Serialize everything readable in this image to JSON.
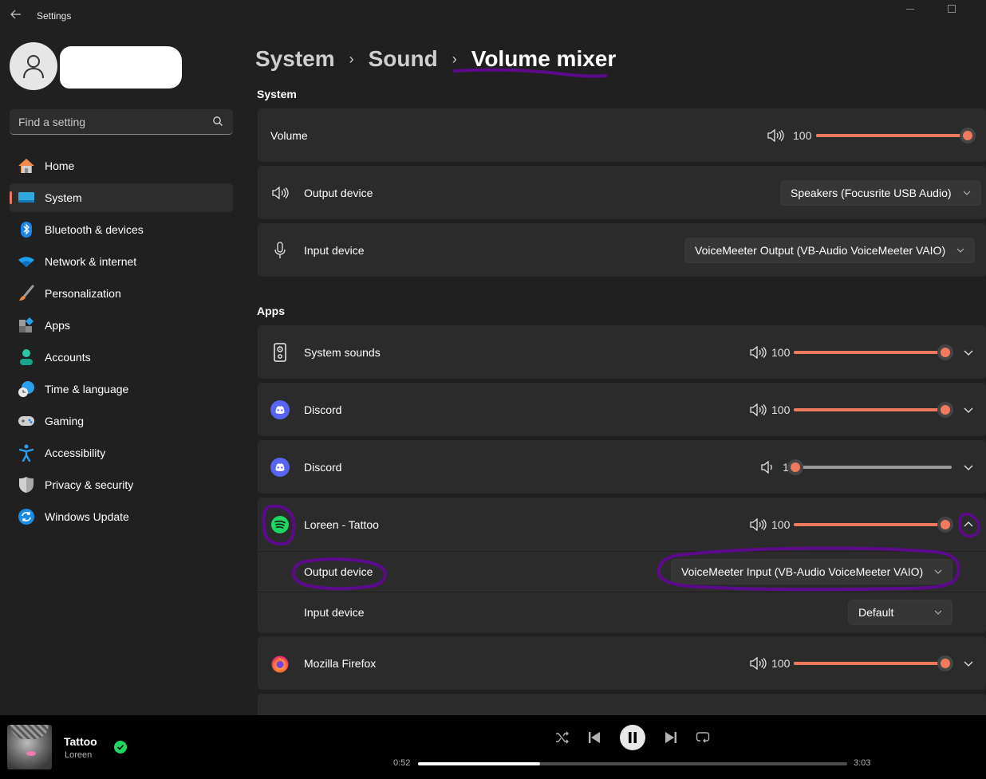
{
  "window": {
    "title": "Settings",
    "back_icon": "back-arrow-icon",
    "minimize_icon": "minimize-icon",
    "maximize_icon": "maximize-icon"
  },
  "sidebar": {
    "avatar_icon": "person-icon",
    "search": {
      "placeholder": "Find a setting",
      "value": "",
      "icon": "search-icon"
    },
    "items": [
      {
        "label": "Home",
        "icon": "home-icon",
        "active": false
      },
      {
        "label": "System",
        "icon": "system-icon",
        "active": true
      },
      {
        "label": "Bluetooth & devices",
        "icon": "bluetooth-icon",
        "active": false
      },
      {
        "label": "Network & internet",
        "icon": "wifi-icon",
        "active": false
      },
      {
        "label": "Personalization",
        "icon": "brush-icon",
        "active": false
      },
      {
        "label": "Apps",
        "icon": "apps-icon",
        "active": false
      },
      {
        "label": "Accounts",
        "icon": "account-icon",
        "active": false
      },
      {
        "label": "Time & language",
        "icon": "globe-clock-icon",
        "active": false
      },
      {
        "label": "Gaming",
        "icon": "gamepad-icon",
        "active": false
      },
      {
        "label": "Accessibility",
        "icon": "accessibility-icon",
        "active": false
      },
      {
        "label": "Privacy & security",
        "icon": "shield-icon",
        "active": false
      },
      {
        "label": "Windows Update",
        "icon": "update-icon",
        "active": false
      }
    ],
    "active_accent": "#f07a5e"
  },
  "breadcrumb": {
    "items": [
      "System",
      "Sound"
    ],
    "separator": "›",
    "current": "Volume mixer"
  },
  "system_section": {
    "title": "System",
    "volume": {
      "label": "Volume",
      "value": 100,
      "value_text": "100",
      "icon": "speaker-icon"
    },
    "output_device": {
      "label": "Output device",
      "icon": "speaker-icon",
      "selected": "Speakers (Focusrite USB Audio)"
    },
    "input_device": {
      "label": "Input device",
      "icon": "microphone-icon",
      "selected": "VoiceMeeter Output (VB-Audio VoiceMeeter VAIO)"
    }
  },
  "apps_section": {
    "title": "Apps",
    "apps": [
      {
        "name": "System sounds",
        "icon": "system-sounds-icon",
        "volume": 100,
        "volume_text": "100",
        "expanded": false
      },
      {
        "name": "Discord",
        "icon": "discord-icon",
        "volume": 100,
        "volume_text": "100",
        "expanded": false
      },
      {
        "name": "Discord",
        "icon": "discord-icon",
        "volume": 1,
        "volume_text": "1",
        "expanded": false
      },
      {
        "name": "Loreen - Tattoo",
        "icon": "spotify-icon",
        "volume": 100,
        "volume_text": "100",
        "expanded": true,
        "output_device": {
          "label": "Output device",
          "selected": "VoiceMeeter Input (VB-Audio VoiceMeeter VAIO)"
        },
        "input_device": {
          "label": "Input device",
          "selected": "Default"
        }
      },
      {
        "name": "Mozilla Firefox",
        "icon": "firefox-icon",
        "volume": 100,
        "volume_text": "100",
        "expanded": false
      }
    ]
  },
  "colors": {
    "accent": "#f07a5e",
    "annotation": "#5b0a8c",
    "spotify_green": "#1ed760",
    "discord_blurple": "#5865f2"
  },
  "player": {
    "track_title": "Tattoo",
    "artist": "Loreen",
    "liked": true,
    "elapsed": "0:52",
    "duration": "3:03",
    "progress": 0.284,
    "controls": [
      "shuffle-icon",
      "previous-icon",
      "pause-icon",
      "next-icon",
      "repeat-icon"
    ]
  }
}
